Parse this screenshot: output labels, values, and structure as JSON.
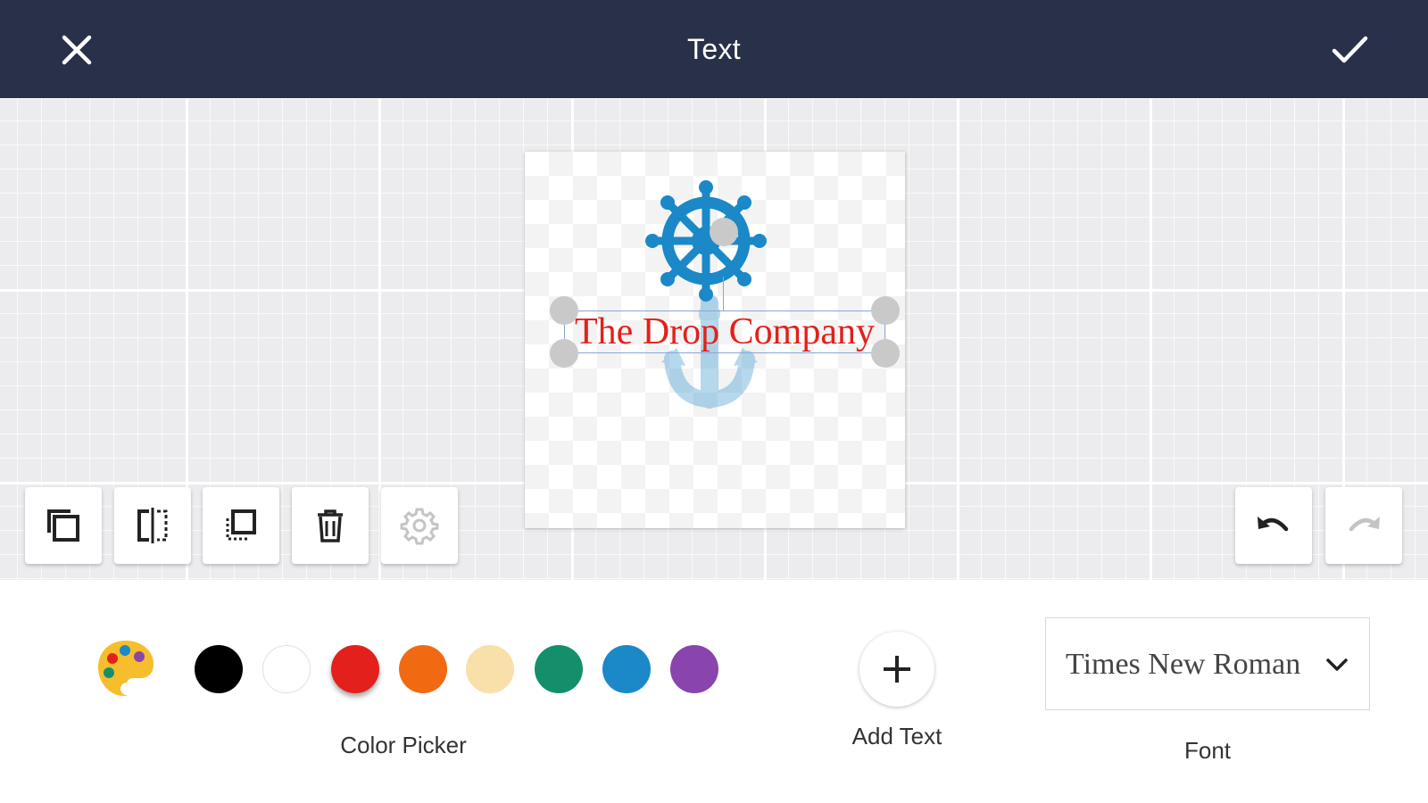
{
  "header": {
    "title": "Text",
    "close_icon": "close-icon",
    "confirm_icon": "check-icon",
    "background": "#29304a"
  },
  "canvas": {
    "logo_text": "The Drop Company",
    "text_color": "#e3201b",
    "graphic": "ship-wheel-anchor",
    "graphic_color": "#1b88c8"
  },
  "toolbar": {
    "left_tools": [
      {
        "icon": "duplicate-icon"
      },
      {
        "icon": "flip-horizontal-icon"
      },
      {
        "icon": "send-backward-icon"
      },
      {
        "icon": "delete-icon"
      },
      {
        "icon": "settings-icon",
        "disabled": true
      }
    ],
    "right_tools": [
      {
        "icon": "undo-icon"
      },
      {
        "icon": "redo-icon",
        "disabled": true
      }
    ]
  },
  "color_picker": {
    "label": "Color Picker",
    "palette_icon": "palette-icon",
    "colors": [
      "#000000",
      "#ffffff",
      "#e3201b",
      "#f16a12",
      "#f9dfa9",
      "#138f6c",
      "#1b88c8",
      "#8a44ad"
    ],
    "selected_color": "#e3201b"
  },
  "add_text": {
    "label": "Add Text",
    "icon": "plus-icon"
  },
  "font": {
    "label": "Font",
    "value": "Times New Roman",
    "icon": "chevron-down-icon"
  }
}
